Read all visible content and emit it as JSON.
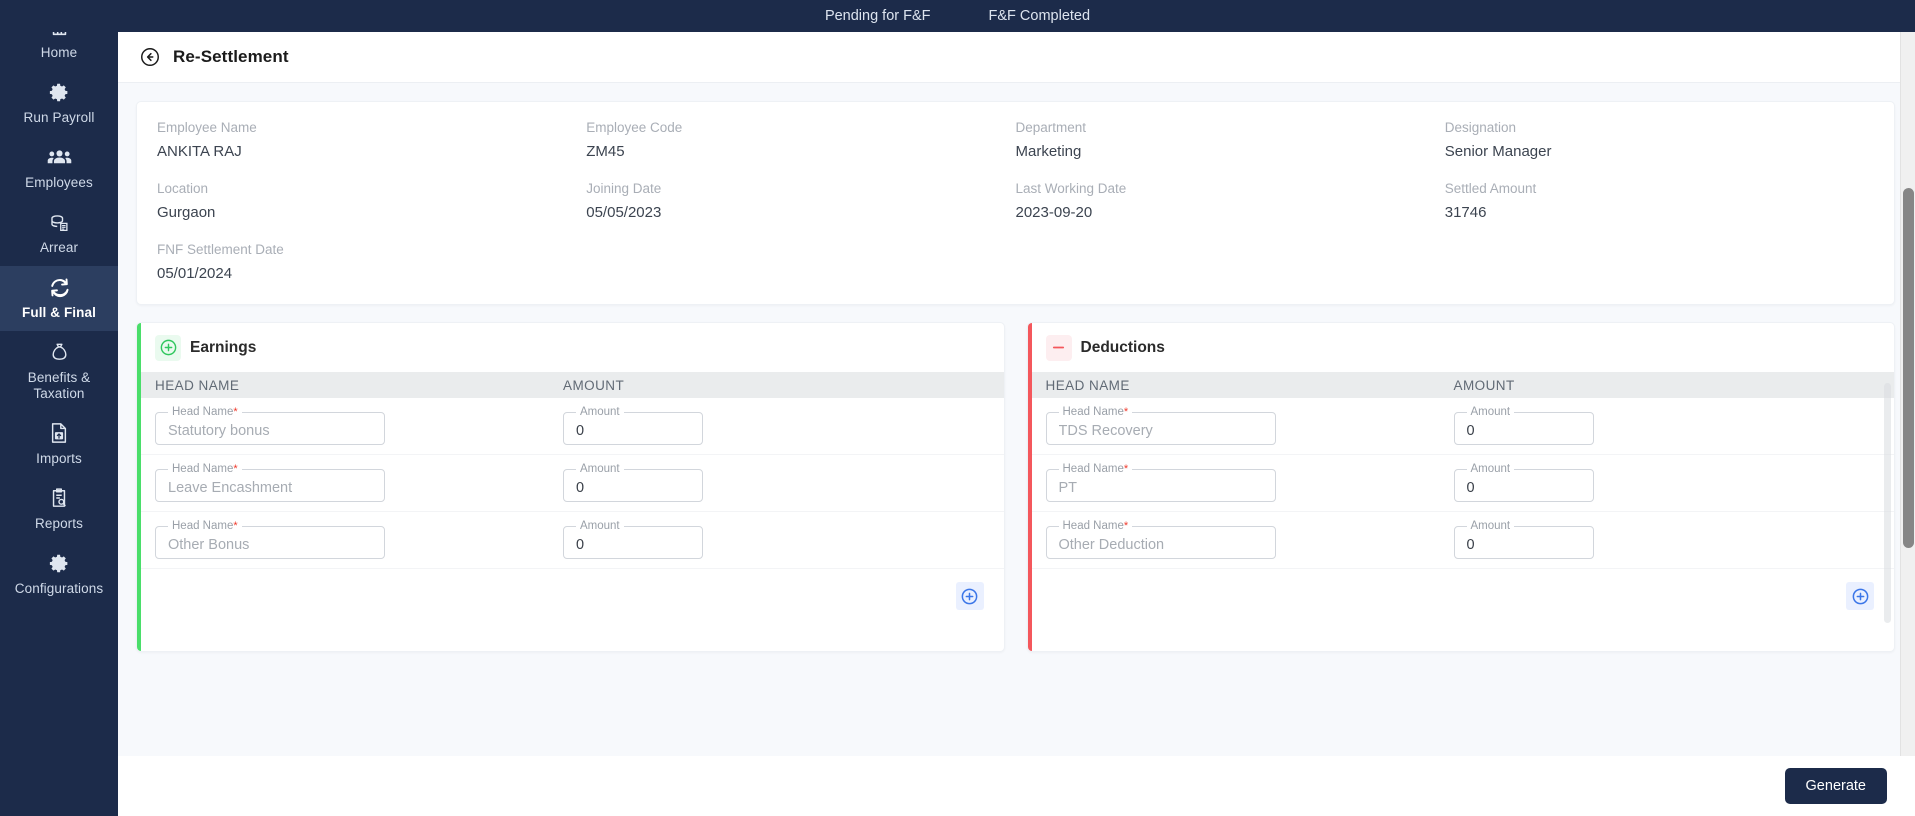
{
  "topbar": {
    "tabs": [
      {
        "label": "Pending for F&F"
      },
      {
        "label": "F&F Completed"
      }
    ]
  },
  "sidebar": {
    "items": [
      {
        "label": "Home",
        "icon": "home-icon",
        "active": false
      },
      {
        "label": "Run Payroll",
        "icon": "gear-icon",
        "active": false
      },
      {
        "label": "Employees",
        "icon": "people-icon",
        "active": false
      },
      {
        "label": "Arrear",
        "icon": "arrear-icon",
        "active": false
      },
      {
        "label": "Full & Final",
        "icon": "refresh-icon",
        "active": true
      },
      {
        "label": "Benefits & Taxation",
        "icon": "moneybag-icon",
        "active": false
      },
      {
        "label": "Imports",
        "icon": "upload-file-icon",
        "active": false
      },
      {
        "label": "Reports",
        "icon": "clipboard-search-icon",
        "active": false
      },
      {
        "label": "Configurations",
        "icon": "gear-icon",
        "active": false
      }
    ]
  },
  "header": {
    "back_icon": "back-arrow-circle-icon",
    "title": "Re-Settlement"
  },
  "employee": {
    "fields": [
      {
        "label": "Employee Name",
        "value": "ANKITA RAJ"
      },
      {
        "label": "Employee Code",
        "value": "ZM45"
      },
      {
        "label": "Department",
        "value": "Marketing"
      },
      {
        "label": "Designation",
        "value": "Senior Manager"
      },
      {
        "label": "Location",
        "value": "Gurgaon"
      },
      {
        "label": "Joining Date",
        "value": "05/05/2023"
      },
      {
        "label": "Last Working Date",
        "value": "2023-09-20"
      },
      {
        "label": "Settled Amount",
        "value": "31746"
      },
      {
        "label": "FNF Settlement Date",
        "value": "05/01/2024"
      }
    ]
  },
  "earnings": {
    "title": "Earnings",
    "badge_icon": "plus-circle-icon",
    "accent_color": "#4ade6a",
    "columns": {
      "head_name": "HEAD NAME",
      "amount": "AMOUNT"
    },
    "field_labels": {
      "head_name": "Head Name",
      "amount": "Amount",
      "required_mark": "*"
    },
    "rows": [
      {
        "head_name_placeholder": "Statutory bonus",
        "head_name_value": "",
        "amount_value": "0"
      },
      {
        "head_name_placeholder": "Leave Encashment",
        "head_name_value": "",
        "amount_value": "0"
      },
      {
        "head_name_placeholder": "Other Bonus",
        "head_name_value": "",
        "amount_value": "0"
      }
    ],
    "add_icon": "plus-circle-icon"
  },
  "deductions": {
    "title": "Deductions",
    "badge_icon": "minus-icon",
    "accent_color": "#f4575c",
    "columns": {
      "head_name": "HEAD NAME",
      "amount": "AMOUNT"
    },
    "field_labels": {
      "head_name": "Head Name",
      "amount": "Amount",
      "required_mark": "*"
    },
    "rows": [
      {
        "head_name_placeholder": "TDS Recovery",
        "head_name_value": "",
        "amount_value": "0"
      },
      {
        "head_name_placeholder": "PT",
        "head_name_value": "",
        "amount_value": "0"
      },
      {
        "head_name_placeholder": "Other Deduction",
        "head_name_value": "",
        "amount_value": "0"
      }
    ],
    "add_icon": "plus-circle-icon"
  },
  "footer": {
    "generate_label": "Generate"
  },
  "colors": {
    "brand_navy": "#1c2b4a",
    "sidebar_active": "#2c3e60",
    "earnings_green": "#4ade6a",
    "deductions_red": "#f4575c",
    "add_blue": "#3b76e8",
    "page_bg": "#f7f9fc"
  }
}
